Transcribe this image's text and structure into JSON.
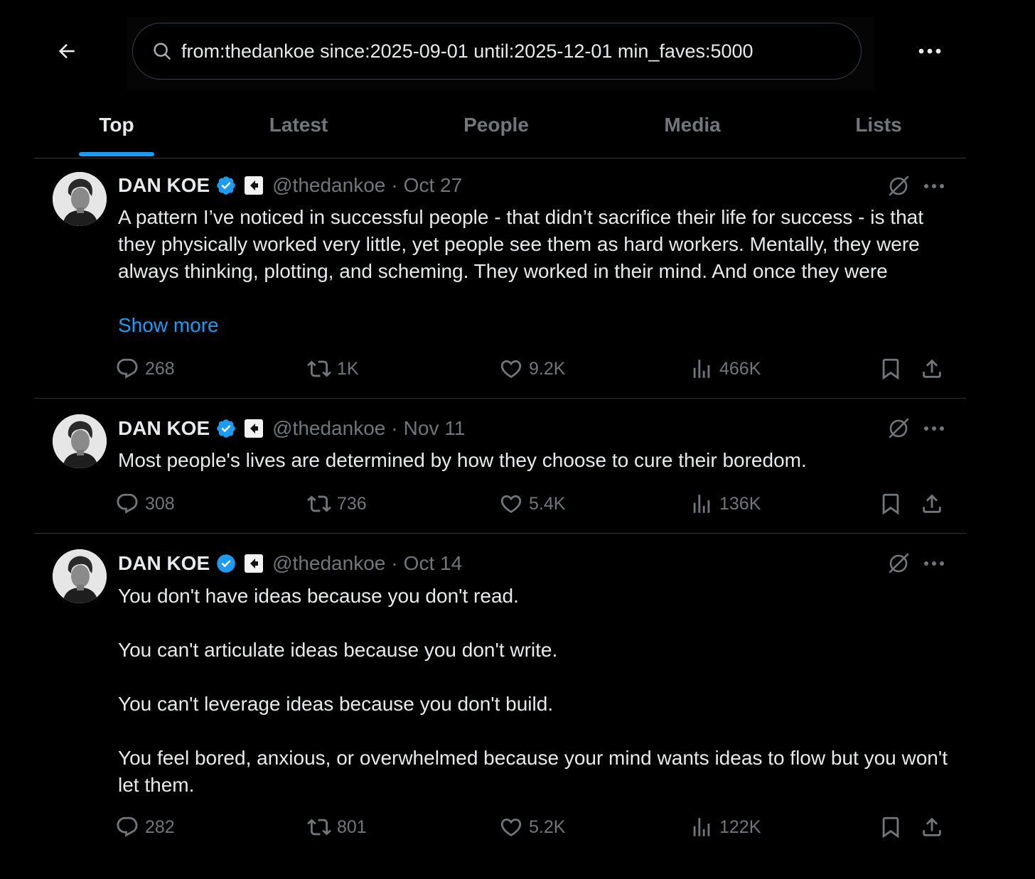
{
  "search": {
    "query": "from:thedankoe since:2025-09-01 until:2025-12-01 min_faves:5000"
  },
  "tabs": [
    {
      "label": "Top"
    },
    {
      "label": "Latest"
    },
    {
      "label": "People"
    },
    {
      "label": "Media"
    },
    {
      "label": "Lists"
    }
  ],
  "active_tab": "Top",
  "colors": {
    "accent": "#1d9bf0",
    "muted": "#71767b",
    "text": "#e7e9ea",
    "background": "#000000"
  },
  "posts": [
    {
      "author": "DAN KOE",
      "handle": "@thedankoe",
      "separator": "·",
      "date": "Oct 27",
      "text": "A pattern I’ve noticed in successful people - that didn’t sacrifice their life for success - is that they physically worked very little, yet people see them as hard workers. Mentally, they were always thinking, plotting, and scheming. They worked in their mind. And once they were",
      "show_more": "Show more",
      "replies": "268",
      "reposts": "1K",
      "likes": "9.2K",
      "views": "466K"
    },
    {
      "author": "DAN KOE",
      "handle": "@thedankoe",
      "separator": "·",
      "date": "Nov 11",
      "text": "Most people's lives are determined by how they choose to cure their boredom.",
      "replies": "308",
      "reposts": "736",
      "likes": "5.4K",
      "views": "136K"
    },
    {
      "author": "DAN KOE",
      "handle": "@thedankoe",
      "separator": "·",
      "date": "Oct 14",
      "text": "You don't have ideas because you don't read.\n\nYou can't articulate ideas because you don't write.\n\nYou can't leverage ideas because you don't build.\n\nYou feel bored, anxious, or overwhelmed because your mind wants ideas to flow but you won't let them.",
      "replies": "282",
      "reposts": "801",
      "likes": "5.2K",
      "views": "122K"
    }
  ]
}
